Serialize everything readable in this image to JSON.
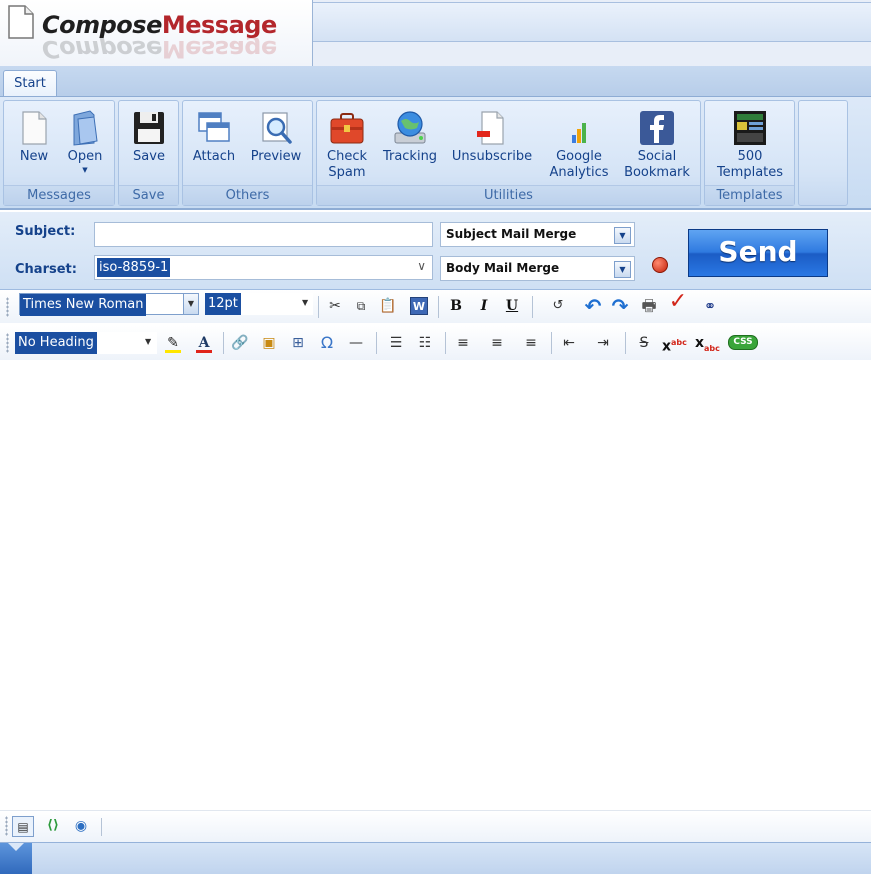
{
  "title": {
    "part1": "Compose",
    "part2": "Message"
  },
  "tabs": [
    {
      "label": "Start"
    }
  ],
  "ribbon": {
    "groups": {
      "messages": {
        "label": "Messages",
        "new": "New",
        "open": "Open"
      },
      "save": {
        "label": "Save",
        "save": "Save"
      },
      "others": {
        "label": "Others",
        "attach": "Attach",
        "preview": "Preview"
      },
      "utilities": {
        "label": "Utilities",
        "check_spam_1": "Check",
        "check_spam_2": "Spam",
        "tracking": "Tracking",
        "unsubscribe": "Unsubscribe",
        "google_analytics_1": "Google",
        "google_analytics_2": "Analytics",
        "social_bookmark_1": "Social",
        "social_bookmark_2": "Bookmark"
      },
      "templates": {
        "label": "Templates",
        "templates_1": "500",
        "templates_2": "Templates"
      }
    }
  },
  "form": {
    "subject_label": "Subject:",
    "subject_value": "",
    "charset_label": "Charset:",
    "charset_value": "iso-8859-1",
    "subject_merge": "Subject Mail Merge",
    "body_merge": "Body Mail Merge",
    "send": "Send"
  },
  "editor": {
    "font_family": "Times New Roman",
    "font_size": "12pt",
    "heading": "No Heading",
    "bold": "B",
    "italic": "I",
    "underline": "U",
    "css": "CSS"
  },
  "icons": {
    "messages": [
      "new-document-icon",
      "open-folder-icon"
    ],
    "save": [
      "floppy-disk-icon"
    ],
    "others": [
      "attach-windows-icon",
      "preview-magnifier-icon"
    ],
    "utilities": [
      "spam-briefcase-icon",
      "tracking-globe-icon",
      "unsubscribe-document-icon",
      "analytics-bars-icon",
      "facebook-icon"
    ],
    "templates": [
      "templates-thumbnail-icon"
    ]
  },
  "colors": {
    "accent": "#15428b",
    "send": "#2f7ae0",
    "title_red": "#b3262b"
  }
}
